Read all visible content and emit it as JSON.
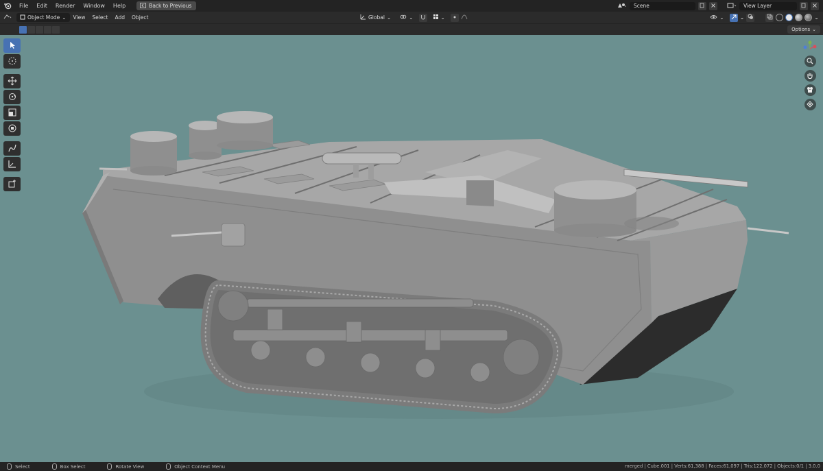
{
  "menu": {
    "items": [
      "File",
      "Edit",
      "Render",
      "Window",
      "Help"
    ],
    "back_button": "Back to Previous"
  },
  "top_right": {
    "scene": "Scene",
    "view_layer": "View Layer"
  },
  "header": {
    "mode": "Object Mode",
    "menus": [
      "View",
      "Select",
      "Add",
      "Object"
    ],
    "transform_orientation": "Global"
  },
  "tool_settings": {
    "options_label": "Options"
  },
  "status_bar": {
    "select": "Select",
    "box_select": "Box Select",
    "rotate_view": "Rotate View",
    "context_menu": "Object Context Menu",
    "stats": "merged | Cube.001 | Verts:61,388 | Faces:61,097 | Tris:122,072 | Objects:0/1 | 3.0.0"
  },
  "colors": {
    "viewport_bg": "#6b9090",
    "accent": "#4772b3",
    "model_gray": "#8c8c8c"
  },
  "icons": {
    "toolbar": [
      "cursor-select-icon",
      "cursor-3d-icon",
      "move-icon",
      "rotate-icon",
      "scale-icon",
      "transform-icon",
      "annotate-icon",
      "measure-icon",
      "add-cube-icon"
    ],
    "navigation": [
      "axis-gizmo-icon",
      "zoom-icon",
      "pan-hand-icon",
      "camera-icon",
      "grid-icon"
    ]
  }
}
